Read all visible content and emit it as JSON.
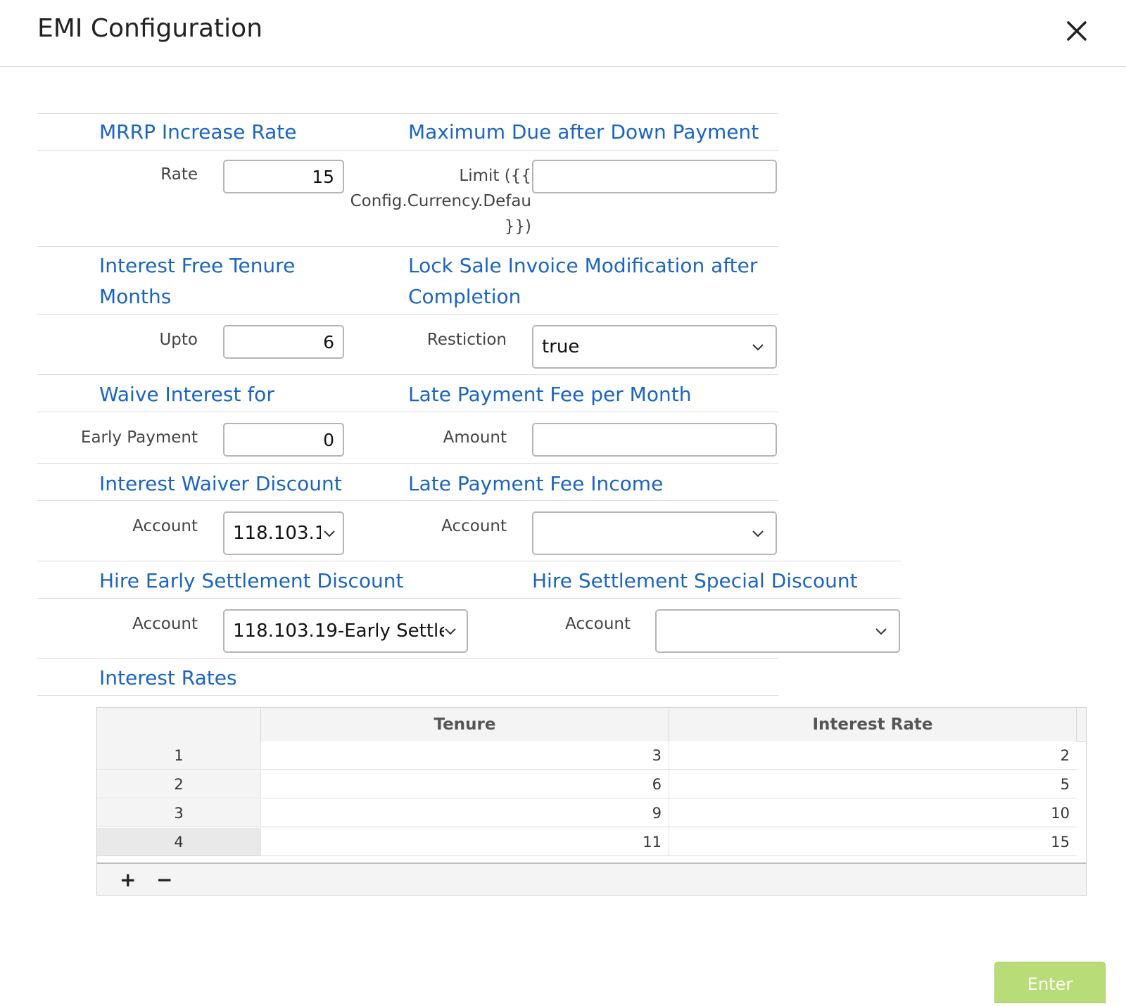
{
  "dialog": {
    "title": "EMI Configuration",
    "close_icon": "close-icon"
  },
  "sections": {
    "mrrp": {
      "title": "MRRP Increase Rate",
      "label": "Rate",
      "value": "15"
    },
    "max_due": {
      "title": "Maximum Due after Down Payment",
      "label": "Limit ({{ Config.Currency.Defau }})",
      "value": ""
    },
    "interest_free": {
      "title": "Interest Free Tenure Months",
      "label": "Upto",
      "value": "6"
    },
    "lock_sale": {
      "title": "Lock Sale Invoice Modification after Completion",
      "label": "Restiction",
      "value": "true"
    },
    "waive_interest": {
      "title": "Waive Interest for",
      "label": "Early Payment",
      "value": "0"
    },
    "late_fee": {
      "title": "Late Payment Fee per Month",
      "label": "Amount",
      "value": ""
    },
    "interest_waiver": {
      "title": "Interest Waiver Discount",
      "label": "Account",
      "value": "118.103.1"
    },
    "late_fee_income": {
      "title": "Late Payment Fee Income",
      "label": "Account",
      "value": ""
    },
    "hire_early": {
      "title": "Hire Early Settlement Discount",
      "label": "Account",
      "value": "118.103.19-Early Settlen"
    },
    "hire_special": {
      "title": "Hire Settlement Special Discount",
      "label": "Account",
      "value": ""
    },
    "interest_rates": {
      "title": "Interest Rates"
    }
  },
  "table": {
    "columns": [
      "Tenure",
      "Interest Rate"
    ],
    "rows": [
      {
        "index": "1",
        "tenure": "3",
        "rate": "2"
      },
      {
        "index": "2",
        "tenure": "6",
        "rate": "5"
      },
      {
        "index": "3",
        "tenure": "9",
        "rate": "10"
      },
      {
        "index": "4",
        "tenure": "11",
        "rate": "15"
      }
    ],
    "add_label": "+",
    "remove_label": "−"
  },
  "footer": {
    "enter_label": "Enter"
  },
  "colors": {
    "section_title": "#1a64c4",
    "enter_button": "#b8dd78"
  }
}
